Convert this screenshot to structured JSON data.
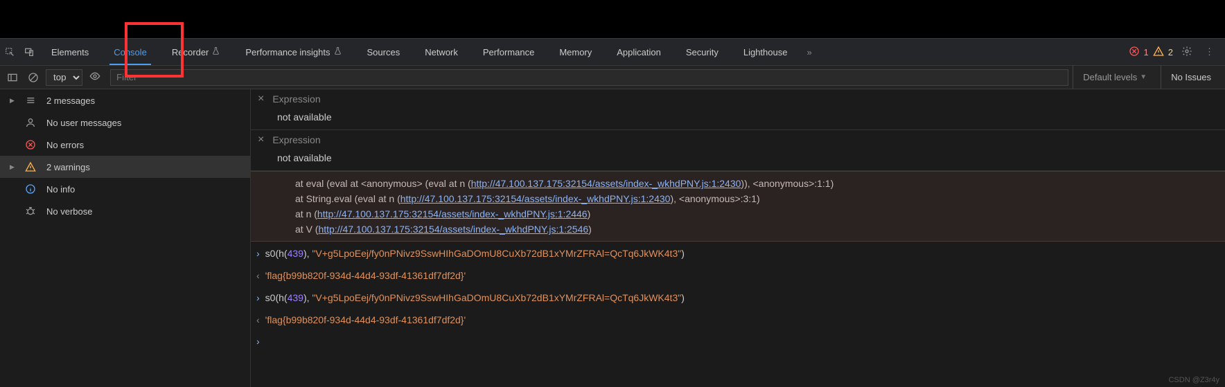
{
  "tabs": {
    "elements": "Elements",
    "console": "Console",
    "recorder": "Recorder",
    "perfInsights": "Performance insights",
    "sources": "Sources",
    "network": "Network",
    "performance": "Performance",
    "memory": "Memory",
    "application": "Application",
    "security": "Security",
    "lighthouse": "Lighthouse"
  },
  "badges": {
    "errors": "1",
    "warnings": "2"
  },
  "toolbar": {
    "context": "top",
    "filterPlaceholder": "Filter",
    "levels": "Default levels",
    "issues": "No Issues"
  },
  "sidebar": {
    "messages": "2 messages",
    "userMessages": "No user messages",
    "errors": "No errors",
    "warnings": "2 warnings",
    "info": "No info",
    "verbose": "No verbose"
  },
  "expr": {
    "label": "Expression",
    "value": "not available"
  },
  "stack": {
    "l1a": "    at eval (eval at <anonymous> (eval at n (",
    "l1url": "http://47.100.137.175:32154/assets/index-_wkhdPNY.js:1:2430",
    "l1b": ")), <anonymous>:1:1)",
    "l2a": "    at String.eval (eval at n (",
    "l2url": "http://47.100.137.175:32154/assets/index-_wkhdPNY.js:1:2430",
    "l2b": "), <anonymous>:3:1)",
    "l3a": "    at n (",
    "l3url": "http://47.100.137.175:32154/assets/index-_wkhdPNY.js:1:2446",
    "l3b": ")",
    "l4a": "    at V (",
    "l4url": "http://47.100.137.175:32154/assets/index-_wkhdPNY.js:1:2546",
    "l4b": ")"
  },
  "cmd": {
    "call_pre": "s0(h(",
    "call_num": "439",
    "call_mid": "), ",
    "call_str": "\"V+g5LpoEej/fy0nPNivz9SswHIhGaDOmU8CuXb72dB1xYMrZFRAl=QcTq6JkWK4t3\"",
    "call_post": ")",
    "result": "'flag{b99b820f-934d-44d4-93df-41361df7df2d}'"
  },
  "watermark": "CSDN @Z3r4y"
}
